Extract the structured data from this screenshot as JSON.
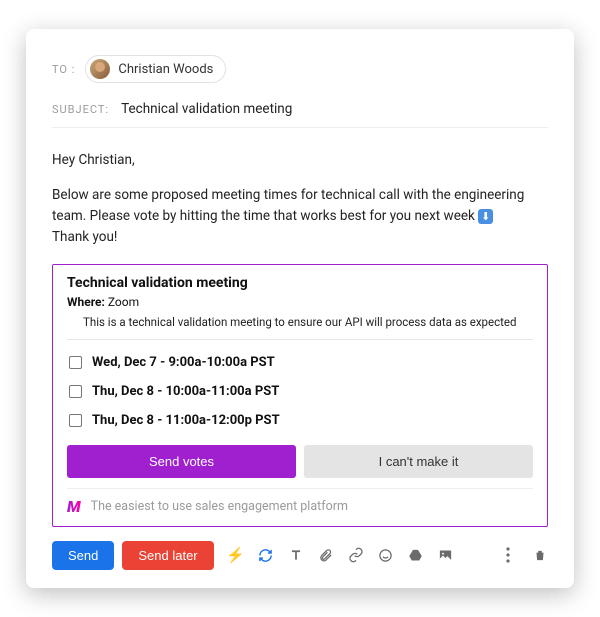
{
  "header": {
    "to_label": "TO :",
    "recipient": "Christian Woods",
    "subject_label": "SUBJECT:",
    "subject": "Technical validation meeting"
  },
  "body": {
    "greeting": "Hey Christian,",
    "paragraph": "Below are some proposed meeting times for technical call with the engineering team.  Please vote by hitting the time that works best for you next week ",
    "thanks": "Thank you!"
  },
  "poll": {
    "title": "Technical validation meeting",
    "where_label": "Where:",
    "where_value": "Zoom",
    "description": "This is a technical validation meeting to ensure our API will process data as expected",
    "options": [
      "Wed, Dec 7 - 9:00a-10:00a PST",
      "Thu, Dec 8 - 10:00a-11:00a PST",
      "Thu, Dec 8 - 11:00a-12:00p PST"
    ],
    "vote_button": "Send votes",
    "cant_button": "I can't make it",
    "footer_tagline": "The easiest to use sales engagement platform"
  },
  "toolbar": {
    "send": "Send",
    "send_later": "Send later"
  }
}
